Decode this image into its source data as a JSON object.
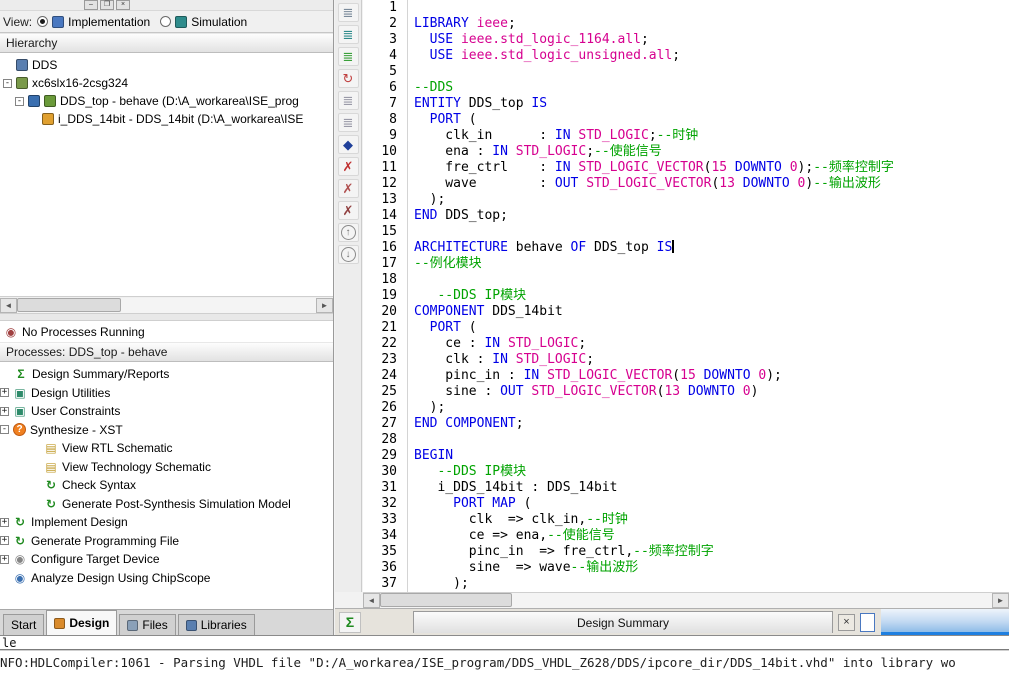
{
  "window_controls": {
    "minimize": "–",
    "restore": "❐",
    "close": "×"
  },
  "icons": {
    "arrow_left": "◄",
    "arrow_right": "►",
    "sigma": "Σ",
    "close": "×",
    "status_glyph": "◉"
  },
  "view_bar": {
    "label": "View:",
    "options": [
      {
        "label": "Implementation",
        "selected": true,
        "icon": "implementation-icon",
        "icon_color": "#4a78c0"
      },
      {
        "label": "Simulation",
        "selected": false,
        "icon": "simulation-icon",
        "icon_color": "#2e8b8b"
      }
    ]
  },
  "hierarchy": {
    "title": "Hierarchy",
    "items": [
      {
        "label": "DDS",
        "pad": 16,
        "expander": "",
        "icon": "dds-project-icon",
        "color": "#5a7fb0"
      },
      {
        "label": "xc6slx16-2csg324",
        "pad": 3,
        "expander": "-",
        "icon": "device-icon",
        "color": "#7a9a4a"
      },
      {
        "label": "DDS_top - behave (D:\\A_workarea\\ISE_prog",
        "pad": 15,
        "expander": "-",
        "icon": "module-icon",
        "color": "#3a6fb0",
        "icon2": "vhdl-file-icon",
        "color2": "#6a9a3a"
      },
      {
        "label": "i_DDS_14bit - DDS_14bit (D:\\A_workarea\\ISE",
        "pad": 42,
        "expander": "",
        "icon": "instance-icon",
        "color": "#e0a030"
      }
    ]
  },
  "processes": {
    "status": "No Processes Running",
    "status_glyph": "◉",
    "title": "Processes: DDS_top - behave",
    "items": [
      {
        "label": "Design Summary/Reports",
        "pad": 14,
        "expander": "",
        "icon": "summary-reports-icon",
        "glyph": "Σ",
        "color": "#1f8a1f"
      },
      {
        "label": "Design Utilities",
        "pad": 0,
        "expander": "+",
        "icon": "design-utilities-icon",
        "glyph": "▣",
        "color": "#2e8b6a"
      },
      {
        "label": "User Constraints",
        "pad": 0,
        "expander": "+",
        "icon": "user-constraints-icon",
        "glyph": "▣",
        "color": "#2e8b6a"
      },
      {
        "label": "Synthesize - XST",
        "pad": 0,
        "expander": "-",
        "icon": "synthesize-xst-icon",
        "glyph": "?",
        "color": "#ffffff",
        "badge": true
      },
      {
        "label": "View RTL Schematic",
        "pad": 44,
        "expander": "",
        "icon": "rtl-schematic-icon",
        "glyph": "▤",
        "color": "#c09a2a"
      },
      {
        "label": "View Technology Schematic",
        "pad": 44,
        "expander": "",
        "icon": "technology-schematic-icon",
        "glyph": "▤",
        "color": "#c09a2a"
      },
      {
        "label": "Check Syntax",
        "pad": 44,
        "expander": "",
        "icon": "check-syntax-icon",
        "glyph": "↻",
        "color": "#1f8a1f"
      },
      {
        "label": "Generate Post-Synthesis Simulation Model",
        "pad": 44,
        "expander": "",
        "icon": "post-synthesis-model-icon",
        "glyph": "↻",
        "color": "#1f8a1f"
      },
      {
        "label": "Implement Design",
        "pad": 0,
        "expander": "+",
        "icon": "implement-design-icon",
        "glyph": "↻",
        "color": "#1f8a1f"
      },
      {
        "label": "Generate Programming File",
        "pad": 0,
        "expander": "+",
        "icon": "generate-programming-file-icon",
        "glyph": "↻",
        "color": "#1f8a1f"
      },
      {
        "label": "Configure Target Device",
        "pad": 0,
        "expander": "+",
        "icon": "configure-target-device-icon",
        "glyph": "◉",
        "color": "#858585"
      },
      {
        "label": "Analyze Design Using ChipScope",
        "pad": 13,
        "expander": "",
        "icon": "chipscope-icon",
        "glyph": "◉",
        "color": "#3a6fb0"
      }
    ]
  },
  "panel_tabs": [
    {
      "label": "Start",
      "active": false
    },
    {
      "label": "Design",
      "active": true,
      "icon": "design-tab-icon",
      "icon_color": "#d98a2b"
    },
    {
      "label": "Files",
      "active": false,
      "icon": "files-tab-icon",
      "icon_color": "#8aa0b8"
    },
    {
      "label": "Libraries",
      "active": false,
      "icon": "libraries-tab-icon",
      "icon_color": "#5a7fb0"
    }
  ],
  "vtoolbar": [
    {
      "name": "outline-view-icon",
      "glyph": "≣",
      "color": "#7a8a9a"
    },
    {
      "name": "goto-line-icon",
      "glyph": "≣",
      "color": "#2e8b8b"
    },
    {
      "name": "language-template-icon",
      "glyph": "≣",
      "color": "#3aa03a"
    },
    {
      "name": "refresh-icon",
      "glyph": "↻",
      "color": "#c04040"
    },
    {
      "name": "indent-icon",
      "glyph": "≣",
      "color": "#9a9aa8"
    },
    {
      "name": "outdent-icon",
      "glyph": "≣",
      "color": "#9a9aa8"
    },
    {
      "name": "toggle-bookmark-icon",
      "glyph": "◆",
      "color": "#20409a"
    },
    {
      "name": "next-bookmark-icon",
      "glyph": "✗",
      "color": "#c03030"
    },
    {
      "name": "prev-bookmark-icon",
      "glyph": "✗",
      "color": "#b05050"
    },
    {
      "name": "clear-bookmarks-icon",
      "glyph": "✗",
      "color": "#904040"
    },
    {
      "name": "scroll-up-icon",
      "glyph": "↑",
      "color": "#707070",
      "circle": true
    },
    {
      "name": "scroll-down-icon",
      "glyph": "↓",
      "color": "#707070",
      "circle": true
    }
  ],
  "editor": {
    "colors": {
      "k": "#0000e6",
      "t": "#d6008f",
      "c": "#00a300",
      "p": "#000000"
    },
    "cursor_line": 16,
    "lines": [
      [],
      [
        [
          "k",
          "LIBRARY "
        ],
        [
          "t",
          "ieee"
        ],
        [
          "p",
          ";"
        ]
      ],
      [
        [
          "p",
          "  "
        ],
        [
          "k",
          "USE "
        ],
        [
          "t",
          "ieee.std_logic_1164.all"
        ],
        [
          "p",
          ";"
        ]
      ],
      [
        [
          "p",
          "  "
        ],
        [
          "k",
          "USE "
        ],
        [
          "t",
          "ieee.std_logic_unsigned.all"
        ],
        [
          "p",
          ";"
        ]
      ],
      [],
      [
        [
          "c",
          "--DDS"
        ]
      ],
      [
        [
          "k",
          "ENTITY "
        ],
        [
          "p",
          "DDS_top "
        ],
        [
          "k",
          "IS"
        ]
      ],
      [
        [
          "p",
          "  "
        ],
        [
          "k",
          "PORT "
        ],
        [
          "p",
          "("
        ]
      ],
      [
        [
          "p",
          "    clk_in      : "
        ],
        [
          "k",
          "IN "
        ],
        [
          "t",
          "STD_LOGIC"
        ],
        [
          "p",
          ";"
        ],
        [
          "c",
          "--时钟"
        ]
      ],
      [
        [
          "p",
          "    ena : "
        ],
        [
          "k",
          "IN "
        ],
        [
          "t",
          "STD_LOGIC"
        ],
        [
          "p",
          ";"
        ],
        [
          "c",
          "--使能信号"
        ]
      ],
      [
        [
          "p",
          "    fre_ctrl    : "
        ],
        [
          "k",
          "IN "
        ],
        [
          "t",
          "STD_LOGIC_VECTOR"
        ],
        [
          "p",
          "("
        ],
        [
          "t",
          "15"
        ],
        [
          "k",
          " DOWNTO "
        ],
        [
          "t",
          "0"
        ],
        [
          "p",
          ");"
        ],
        [
          "c",
          "--频率控制字"
        ]
      ],
      [
        [
          "p",
          "    wave        : "
        ],
        [
          "k",
          "OUT "
        ],
        [
          "t",
          "STD_LOGIC_VECTOR"
        ],
        [
          "p",
          "("
        ],
        [
          "t",
          "13"
        ],
        [
          "k",
          " DOWNTO "
        ],
        [
          "t",
          "0"
        ],
        [
          "p",
          ")"
        ],
        [
          "c",
          "--输出波形"
        ]
      ],
      [
        [
          "p",
          "  );"
        ]
      ],
      [
        [
          "k",
          "END "
        ],
        [
          "p",
          "DDS_top;"
        ]
      ],
      [],
      [
        [
          "k",
          "ARCHITECTURE "
        ],
        [
          "p",
          "behave "
        ],
        [
          "k",
          "OF "
        ],
        [
          "p",
          "DDS_top "
        ],
        [
          "k",
          "IS"
        ]
      ],
      [
        [
          "c",
          "--例化模块"
        ]
      ],
      [],
      [
        [
          "p",
          "   "
        ],
        [
          "c",
          "--DDS IP模块"
        ]
      ],
      [
        [
          "k",
          "COMPONENT "
        ],
        [
          "p",
          "DDS_14bit"
        ]
      ],
      [
        [
          "p",
          "  "
        ],
        [
          "k",
          "PORT "
        ],
        [
          "p",
          "("
        ]
      ],
      [
        [
          "p",
          "    ce : "
        ],
        [
          "k",
          "IN "
        ],
        [
          "t",
          "STD_LOGIC"
        ],
        [
          "p",
          ";"
        ]
      ],
      [
        [
          "p",
          "    clk : "
        ],
        [
          "k",
          "IN "
        ],
        [
          "t",
          "STD_LOGIC"
        ],
        [
          "p",
          ";"
        ]
      ],
      [
        [
          "p",
          "    pinc_in : "
        ],
        [
          "k",
          "IN "
        ],
        [
          "t",
          "STD_LOGIC_VECTOR"
        ],
        [
          "p",
          "("
        ],
        [
          "t",
          "15"
        ],
        [
          "k",
          " DOWNTO "
        ],
        [
          "t",
          "0"
        ],
        [
          "p",
          ");"
        ]
      ],
      [
        [
          "p",
          "    sine : "
        ],
        [
          "k",
          "OUT "
        ],
        [
          "t",
          "STD_LOGIC_VECTOR"
        ],
        [
          "p",
          "("
        ],
        [
          "t",
          "13"
        ],
        [
          "k",
          " DOWNTO "
        ],
        [
          "t",
          "0"
        ],
        [
          "p",
          ")"
        ]
      ],
      [
        [
          "p",
          "  );"
        ]
      ],
      [
        [
          "k",
          "END COMPONENT"
        ],
        [
          "p",
          ";"
        ]
      ],
      [],
      [
        [
          "k",
          "BEGIN"
        ]
      ],
      [
        [
          "p",
          "   "
        ],
        [
          "c",
          "--DDS IP模块"
        ]
      ],
      [
        [
          "p",
          "   i_DDS_14bit : DDS_14bit"
        ]
      ],
      [
        [
          "p",
          "     "
        ],
        [
          "k",
          "PORT MAP "
        ],
        [
          "p",
          "("
        ]
      ],
      [
        [
          "p",
          "       clk  => clk_in,"
        ],
        [
          "c",
          "--时钟"
        ]
      ],
      [
        [
          "p",
          "       ce => ena,"
        ],
        [
          "c",
          "--使能信号"
        ]
      ],
      [
        [
          "p",
          "       pinc_in  => fre_ctrl,"
        ],
        [
          "c",
          "--频率控制字"
        ]
      ],
      [
        [
          "p",
          "       sine  => wave"
        ],
        [
          "c",
          "--输出波形"
        ]
      ],
      [
        [
          "p",
          "     );"
        ]
      ]
    ]
  },
  "summary_bar": {
    "tab": "Design Summary"
  },
  "console": {
    "partial": "le",
    "message": "NFO:HDLCompiler:1061 - Parsing VHDL file \"D:/A_workarea/ISE_program/DDS_VHDL_Z628/DDS/ipcore_dir/DDS_14bit.vhd\" into library wo"
  }
}
